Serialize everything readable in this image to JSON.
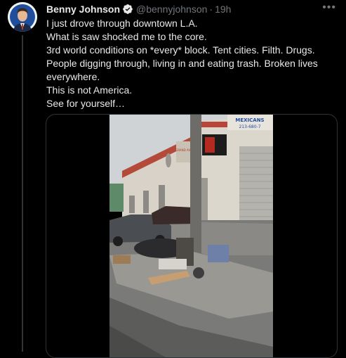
{
  "author": {
    "name": "Benny Johnson",
    "handle": "@bennyjohnson",
    "separator": "·",
    "time": "19h"
  },
  "tweet": {
    "lines": [
      "I just drove through downtown L.A.",
      "What is saw shocked me to the core.",
      "3rd world conditions on *every* block. Tent cities. Filth. Drugs. People digging through, living in and eating trash. Broken lives everywhere.",
      "This is not America.",
      "See for yourself…"
    ]
  },
  "media": {
    "type": "video",
    "storefront_sign": "MEXICANS",
    "storefront_phone": "213-680-7",
    "wall_sign": "GRAND AVE"
  },
  "icons": {
    "verified": "verified-badge-icon",
    "more": "more-options-icon",
    "avatar": "profile-avatar"
  },
  "colors": {
    "background": "#000000",
    "text": "#e7e9ea",
    "secondary": "#71767b",
    "verified": "#e7e9ea"
  }
}
